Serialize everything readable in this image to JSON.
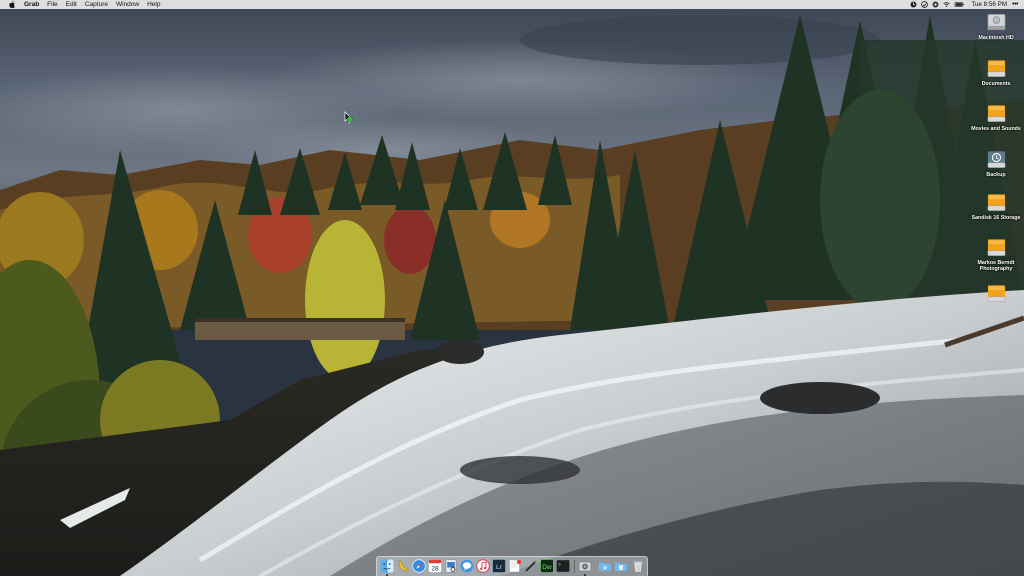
{
  "menubar": {
    "apple_icon": "apple-logo-icon",
    "app_name": "Grab",
    "menus": [
      "File",
      "Edit",
      "Capture",
      "Window",
      "Help"
    ],
    "status_icons": [
      "status-app-icon-1",
      "status-app-icon-2",
      "status-app-icon-3",
      "wifi-icon",
      "battery-icon"
    ],
    "clock": "Tue 8:56 PM",
    "overflow": "•••"
  },
  "desktop_icons": [
    {
      "label": "Macintosh HD",
      "icon": "hard-drive-icon",
      "color": "#c8c8cc"
    },
    {
      "label": "Documents",
      "icon": "external-drive-icon",
      "color": "#f2a31b"
    },
    {
      "label": "Movies and Sounds",
      "icon": "external-drive-icon",
      "color": "#f2a31b"
    },
    {
      "label": "Backup",
      "icon": "time-machine-drive-icon",
      "color": "#5f7e8c"
    },
    {
      "label": "Sandisk 16 Storage",
      "icon": "external-drive-icon",
      "color": "#f2a31b"
    },
    {
      "label": "Markos Berndt Photography",
      "icon": "external-drive-icon",
      "color": "#f2a31b"
    },
    {
      "label": "",
      "icon": "external-drive-icon",
      "color": "#f2a31b"
    }
  ],
  "dock": {
    "apps": [
      {
        "name": "finder-icon",
        "label": "Finder",
        "running": true
      },
      {
        "name": "banana-app-icon",
        "label": "",
        "running": false
      },
      {
        "name": "safari-icon",
        "label": "",
        "running": false
      },
      {
        "name": "calendar-icon",
        "label": "28",
        "running": false
      },
      {
        "name": "preview-icon",
        "label": "",
        "running": false
      },
      {
        "name": "chat-app-icon",
        "label": "",
        "running": false
      },
      {
        "name": "itunes-icon",
        "label": "",
        "running": false
      },
      {
        "name": "lightroom-icon",
        "label": "Lr",
        "running": false
      },
      {
        "name": "notes-app-icon",
        "label": "",
        "running": false
      },
      {
        "name": "pen-tool-icon",
        "label": "",
        "running": false
      },
      {
        "name": "dreamweaver-icon",
        "label": "Dw",
        "running": false
      },
      {
        "name": "terminal-icon",
        "label": "",
        "running": false
      },
      {
        "name": "grab-icon",
        "label": "",
        "running": true
      }
    ],
    "stacks": [
      {
        "name": "downloads-folder-icon"
      },
      {
        "name": "documents-folder-icon"
      },
      {
        "name": "trash-icon"
      }
    ]
  },
  "colors": {
    "menubar_bg": "#ececee",
    "drive_orange": "#f2a31b",
    "sky": "#4b5566",
    "water": "#e8ecef"
  }
}
